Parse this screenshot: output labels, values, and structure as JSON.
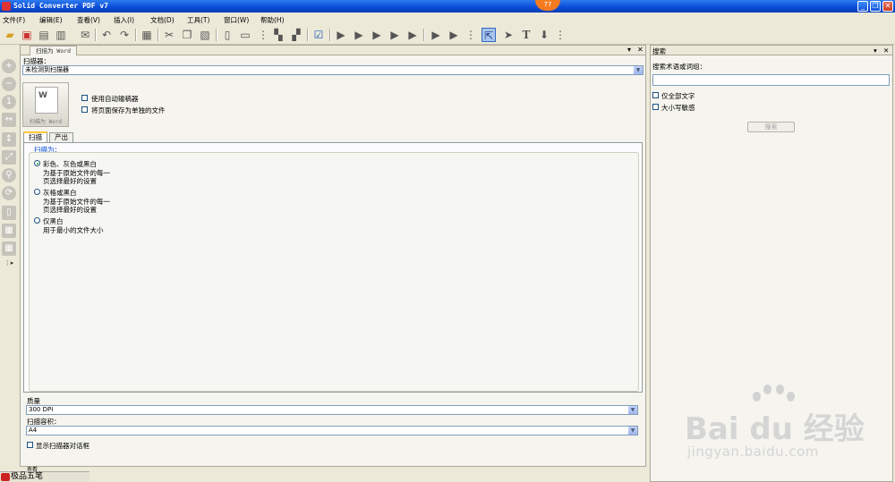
{
  "window": {
    "title": "Solid Converter PDF v7",
    "badge": "77"
  },
  "menu": [
    "文件(F)",
    "编辑(E)",
    "查看(V)",
    "插入(I)",
    "文档(D)",
    "工具(T)",
    "窗口(W)",
    "帮助(H)"
  ],
  "main_panel": {
    "tab_title": "扫描为 Word",
    "scanner_label": "扫描器：",
    "scanner_value": "未检测到扫描器",
    "word_caption": "扫描为 Word",
    "checkbox_auto_feeder": "使用自动输稿器",
    "checkbox_separate_files": "将页面保存为单独的文件",
    "tabs": [
      "扫描",
      "产出"
    ],
    "scan_as_label": "扫描为：",
    "options": [
      {
        "title": "彩色、灰色或黑白",
        "desc1": "为基于原始文件的每一",
        "desc2": "页选择最好的设置"
      },
      {
        "title": "灰格或黑白",
        "desc1": "为基于原始文件的每一",
        "desc2": "页选择最好的设置"
      },
      {
        "title": "仅黑白",
        "desc1": "用于最小的文件大小",
        "desc2": ""
      }
    ],
    "quality_label": "质量",
    "quality_value": "300 DPI",
    "paper_label": "扫描容积：",
    "paper_value": "A4",
    "show_dialog_label": "显示扫描器对话框",
    "bottom_tab": "查看"
  },
  "right_panel": {
    "title": "搜索",
    "search_label": "搜索术语或词组：",
    "search_value": "",
    "whole_word_label": "仅全部文字",
    "match_case_label": "大小写敏感",
    "search_button": "搜索"
  },
  "status": {
    "ime_text": "极品五笔"
  },
  "watermark": {
    "brand": "Bai du 经验",
    "url": "jingyan.baidu.com"
  }
}
